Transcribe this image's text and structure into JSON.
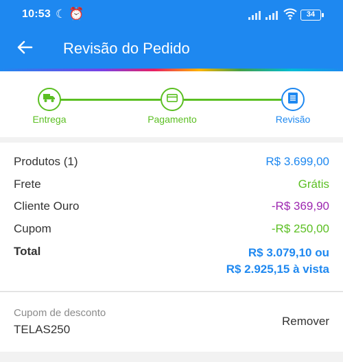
{
  "status_bar": {
    "time": "10:53",
    "battery": "34"
  },
  "header": {
    "title": "Revisão do Pedido",
    "background_color": "#1e88f0"
  },
  "stepper": {
    "steps": [
      {
        "label": "Entrega",
        "icon": "truck-icon",
        "state": "done"
      },
      {
        "label": "Pagamento",
        "icon": "credit-card-icon",
        "state": "done"
      },
      {
        "label": "Revisão",
        "icon": "list-icon",
        "state": "active"
      }
    ]
  },
  "summary": {
    "rows": [
      {
        "label": "Produtos (1)",
        "value": "R$ 3.699,00",
        "color": "#1e88f0"
      },
      {
        "label": "Frete",
        "value": "Grátis",
        "color": "#5bbf22"
      },
      {
        "label": "Cliente Ouro",
        "value": "-R$ 369,90",
        "color": "#9c27b0"
      },
      {
        "label": "Cupom",
        "value": "-R$ 250,00",
        "color": "#5bbf22"
      }
    ],
    "total": {
      "label": "Total",
      "value_line1": "R$ 3.079,10 ou",
      "value_line2": "R$ 2.925,15 à vista"
    }
  },
  "coupon": {
    "label": "Cupom de desconto",
    "code": "TELAS250",
    "remove_label": "Remover"
  }
}
